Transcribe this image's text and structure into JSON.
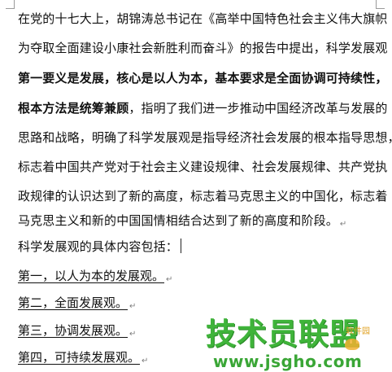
{
  "paragraph": {
    "lines": [
      "在党的十七大上，胡锦涛总书记在《高举中国特色社会主义伟大旗帜",
      "为夺取全面建设小康社会新胜利而奋斗》的报告中提出，科学发展观",
      "第一要义是发展，核心是以人为本，基本要求是全面协调可持续性，",
      "根本方法是统筹兼顾",
      "，指明了我们进一步推动中国经济改革与发展的",
      "思路和战略，明确了科学发展观是指导经济社会发展的根本指导思想，",
      "标志着中国共产党对于社会主义建设规律、社会发展规律、共产党执",
      "政规律的认识达到了新的高度，标志着马克思主义的中国化，标志着",
      "马克思主义和新的中国国情相结合达到了新的高度和阶段。"
    ]
  },
  "intro": "科学发展观的具体内容包括：",
  "list": [
    "第一，以人为本的发展观。",
    "第二，全面发展观。",
    "第三，协调发展观。",
    "第四，可持续发展观。"
  ],
  "paragraph_mark": "↵",
  "watermark": {
    "main": "技术员联盟",
    "sub": "软件园",
    "url": "www.jsgho.com"
  }
}
